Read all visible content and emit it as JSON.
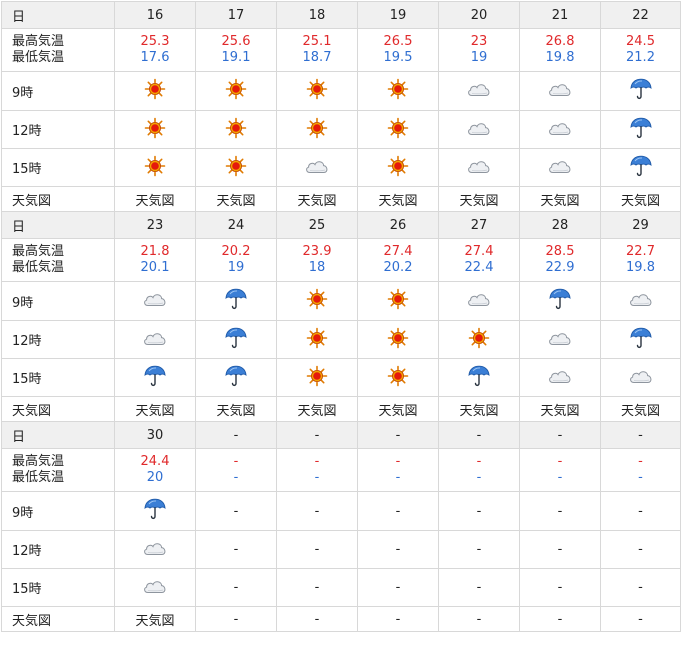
{
  "labels": {
    "day": "日",
    "high": "最高気温",
    "low": "最低気温",
    "t9": "9時",
    "t12": "12時",
    "t15": "15時",
    "map": "天気図"
  },
  "blocks": [
    {
      "days": [
        {
          "day": "16",
          "high": "25.3",
          "low": "17.6",
          "w9": "sunny-icon",
          "w12": "sunny-icon",
          "w15": "sunny-icon",
          "map": "天気図"
        },
        {
          "day": "17",
          "high": "25.6",
          "low": "19.1",
          "w9": "sunny-icon",
          "w12": "sunny-icon",
          "w15": "sunny-icon",
          "map": "天気図"
        },
        {
          "day": "18",
          "high": "25.1",
          "low": "18.7",
          "w9": "sunny-icon",
          "w12": "sunny-icon",
          "w15": "cloudy-icon",
          "map": "天気図"
        },
        {
          "day": "19",
          "high": "26.5",
          "low": "19.5",
          "w9": "sunny-icon",
          "w12": "sunny-icon",
          "w15": "sunny-icon",
          "map": "天気図"
        },
        {
          "day": "20",
          "high": "23",
          "low": "19",
          "w9": "cloudy-icon",
          "w12": "cloudy-icon",
          "w15": "cloudy-icon",
          "map": "天気図"
        },
        {
          "day": "21",
          "high": "26.8",
          "low": "19.8",
          "w9": "cloudy-icon",
          "w12": "cloudy-icon",
          "w15": "cloudy-icon",
          "map": "天気図"
        },
        {
          "day": "22",
          "high": "24.5",
          "low": "21.2",
          "w9": "rain-icon",
          "w12": "rain-icon",
          "w15": "rain-icon",
          "map": "天気図"
        }
      ]
    },
    {
      "days": [
        {
          "day": "23",
          "high": "21.8",
          "low": "20.1",
          "w9": "cloudy-icon",
          "w12": "cloudy-icon",
          "w15": "rain-icon",
          "map": "天気図"
        },
        {
          "day": "24",
          "high": "20.2",
          "low": "19",
          "w9": "rain-icon",
          "w12": "rain-icon",
          "w15": "rain-icon",
          "map": "天気図"
        },
        {
          "day": "25",
          "high": "23.9",
          "low": "18",
          "w9": "sunny-icon",
          "w12": "sunny-icon",
          "w15": "sunny-icon",
          "map": "天気図"
        },
        {
          "day": "26",
          "high": "27.4",
          "low": "20.2",
          "w9": "sunny-icon",
          "w12": "sunny-icon",
          "w15": "sunny-icon",
          "map": "天気図"
        },
        {
          "day": "27",
          "high": "27.4",
          "low": "22.4",
          "w9": "cloudy-icon",
          "w12": "sunny-icon",
          "w15": "rain-icon",
          "map": "天気図"
        },
        {
          "day": "28",
          "high": "28.5",
          "low": "22.9",
          "w9": "rain-icon",
          "w12": "cloudy-icon",
          "w15": "cloudy-icon",
          "map": "天気図"
        },
        {
          "day": "29",
          "high": "22.7",
          "low": "19.8",
          "w9": "cloudy-icon",
          "w12": "rain-icon",
          "w15": "cloudy-icon",
          "map": "天気図"
        }
      ]
    },
    {
      "days": [
        {
          "day": "30",
          "high": "24.4",
          "low": "20",
          "w9": "rain-icon",
          "w12": "cloudy-icon",
          "w15": "cloudy-icon",
          "map": "天気図"
        },
        {
          "day": "-",
          "high": "-",
          "low": "-",
          "w9": "-",
          "w12": "-",
          "w15": "-",
          "map": "-"
        },
        {
          "day": "-",
          "high": "-",
          "low": "-",
          "w9": "-",
          "w12": "-",
          "w15": "-",
          "map": "-"
        },
        {
          "day": "-",
          "high": "-",
          "low": "-",
          "w9": "-",
          "w12": "-",
          "w15": "-",
          "map": "-"
        },
        {
          "day": "-",
          "high": "-",
          "low": "-",
          "w9": "-",
          "w12": "-",
          "w15": "-",
          "map": "-"
        },
        {
          "day": "-",
          "high": "-",
          "low": "-",
          "w9": "-",
          "w12": "-",
          "w15": "-",
          "map": "-"
        },
        {
          "day": "-",
          "high": "-",
          "low": "-",
          "w9": "-",
          "w12": "-",
          "w15": "-",
          "map": "-"
        }
      ]
    }
  ],
  "colors": {
    "high": "#e0292b",
    "low": "#2f6ed1",
    "header_bg": "#f0f0f0",
    "border": "#d8d8d8"
  }
}
